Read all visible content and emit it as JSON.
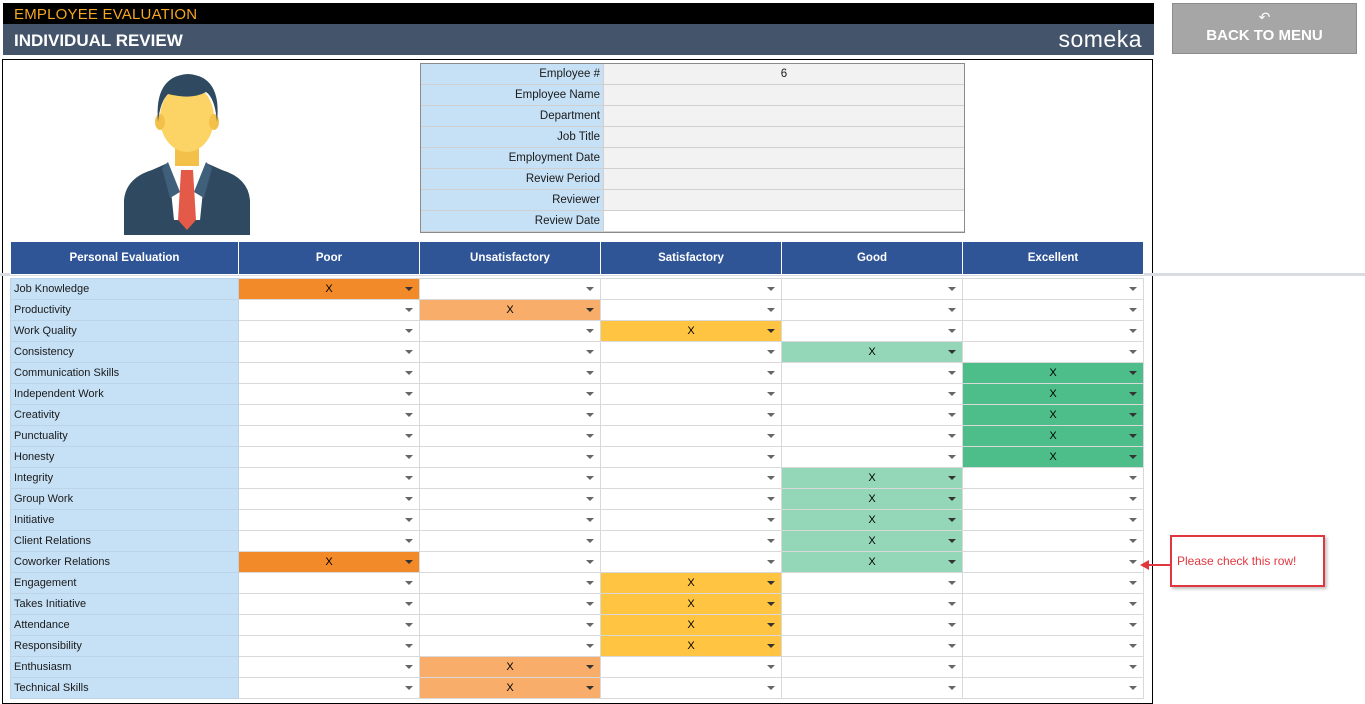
{
  "header": {
    "title": "EMPLOYEE EVALUATION",
    "subtitle": "INDIVIDUAL REVIEW",
    "logo": "someka"
  },
  "back_button": {
    "icon": "undo-arrow-icon",
    "label": "BACK TO MENU"
  },
  "employee_info": [
    {
      "label": "Employee #",
      "value": "6"
    },
    {
      "label": "Employee Name",
      "value": ""
    },
    {
      "label": "Department",
      "value": ""
    },
    {
      "label": "Job Title",
      "value": ""
    },
    {
      "label": "Employment Date",
      "value": ""
    },
    {
      "label": "Review Period",
      "value": ""
    },
    {
      "label": "Reviewer",
      "value": ""
    },
    {
      "label": "Review Date",
      "value": ""
    }
  ],
  "evaluation": {
    "headers": [
      "Personal Evaluation",
      "Poor",
      "Unsatisfactory",
      "Satisfactory",
      "Good",
      "Excellent"
    ],
    "level_colors": [
      "#f28a2a",
      "#f8ad6b",
      "#ffc542",
      "#93d6b8",
      "#4dbd89"
    ],
    "mark": "X",
    "rows": [
      {
        "name": "Job Knowledge",
        "rating": 0
      },
      {
        "name": "Productivity",
        "rating": 1
      },
      {
        "name": "Work Quality",
        "rating": 2
      },
      {
        "name": "Consistency",
        "rating": 3
      },
      {
        "name": "Communication Skills",
        "rating": 4
      },
      {
        "name": "Independent Work",
        "rating": 4
      },
      {
        "name": "Creativity",
        "rating": 4
      },
      {
        "name": "Punctuality",
        "rating": 4
      },
      {
        "name": "Honesty",
        "rating": 4
      },
      {
        "name": "Integrity",
        "rating": 3
      },
      {
        "name": "Group Work",
        "rating": 3
      },
      {
        "name": "Initiative",
        "rating": 3
      },
      {
        "name": "Client Relations",
        "rating": 3
      },
      {
        "name": "Coworker Relations",
        "ratings": [
          0,
          3
        ]
      },
      {
        "name": "Engagement",
        "rating": 2
      },
      {
        "name": "Takes Initiative",
        "rating": 2
      },
      {
        "name": "Attendance",
        "rating": 2
      },
      {
        "name": "Responsibility",
        "rating": 2
      },
      {
        "name": "Enthusiasm",
        "rating": 1
      },
      {
        "name": "Technical Skills",
        "rating": 1
      }
    ]
  },
  "warning": {
    "text": "Please check this row!",
    "color": "#e0373e"
  }
}
